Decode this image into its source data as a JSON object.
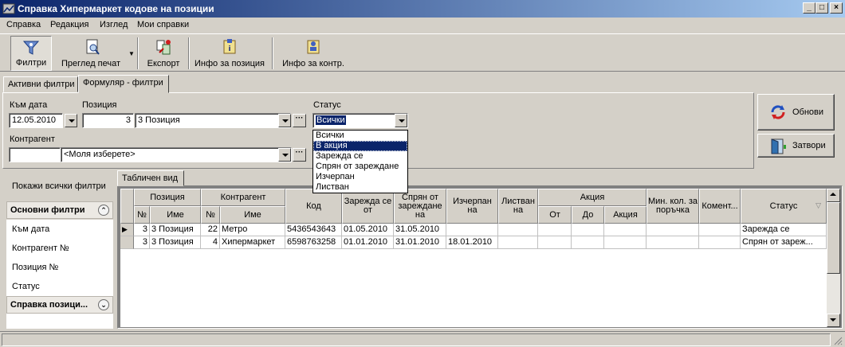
{
  "window": {
    "title": "Справка Хипермаркет кодове на позиции",
    "controls": {
      "minimize": "_",
      "restore": "□",
      "close": "×"
    }
  },
  "menu": [
    "Справка",
    "Редакция",
    "Изглед",
    "Мои справки"
  ],
  "toolbar": {
    "filters": "Филтри",
    "print_preview": "Преглед печат",
    "export": "Експорт",
    "position_info": "Инфо за позиция",
    "contragent_info": "Инфо за контр."
  },
  "tabs": {
    "active_filters": "Активни филтри",
    "form_filters": "Формуляр - филтри"
  },
  "filters": {
    "date_label": "Към дата",
    "date_value": "12.05.2010",
    "position_label": "Позиция",
    "position_num": "3",
    "position_name": "3 Позиция",
    "status_label": "Статус",
    "status_value": "Всички",
    "contragent_label": "Контрагент",
    "contragent_num": "",
    "contragent_placeholder": "<Моля изберете>",
    "status_options": [
      "Всички",
      "В акция",
      "Зарежда се",
      "Спрян от зареждане",
      "Изчерпан",
      "Листван"
    ],
    "status_highlighted": "В акция"
  },
  "buttons": {
    "refresh": "Обнови",
    "close": "Затвори"
  },
  "left_panel": {
    "show_all": "Покажи всички филтри",
    "group1": "Основни филтри",
    "items": [
      "Към дата",
      "Контрагент №",
      "Позиция №",
      "Статус"
    ],
    "group2": "Справка позици..."
  },
  "grid": {
    "tab": "Табличен вид",
    "headers": {
      "position": "Позиция",
      "pos_no": "№",
      "pos_name": "Име",
      "contragent": "Контрагент",
      "con_no": "№",
      "con_name": "Име",
      "code": "Код",
      "loading_from": "Зарежда се от",
      "stopped": "Спрян от зареждане на",
      "exhausted": "Изчерпан на",
      "listed": "Листван на",
      "promo": "Акция",
      "promo_from": "От",
      "promo_to": "До",
      "promo_name": "Акция",
      "min_qty": "Мин. кол. за поръчка",
      "comment": "Комент...",
      "status": "Статус"
    },
    "rows": [
      {
        "pos_no": "3",
        "pos_name": "3 Позиция",
        "con_no": "22",
        "con_name": "Метро",
        "code": "5436543643",
        "loading_from": "01.05.2010",
        "stopped": "31.05.2010",
        "exhausted": "",
        "status": "Зарежда се"
      },
      {
        "pos_no": "3",
        "pos_name": "3 Позиция",
        "con_no": "4",
        "con_name": "Хипермаркет",
        "code": "6598763258",
        "loading_from": "01.01.2010",
        "stopped": "31.01.2010",
        "exhausted": "18.01.2010",
        "status": "Спрян от зареж..."
      }
    ]
  },
  "colors": {
    "title_start": "#0a246a",
    "title_end": "#a6caf0",
    "selection": "#0a246a",
    "face": "#d4d0c8"
  }
}
